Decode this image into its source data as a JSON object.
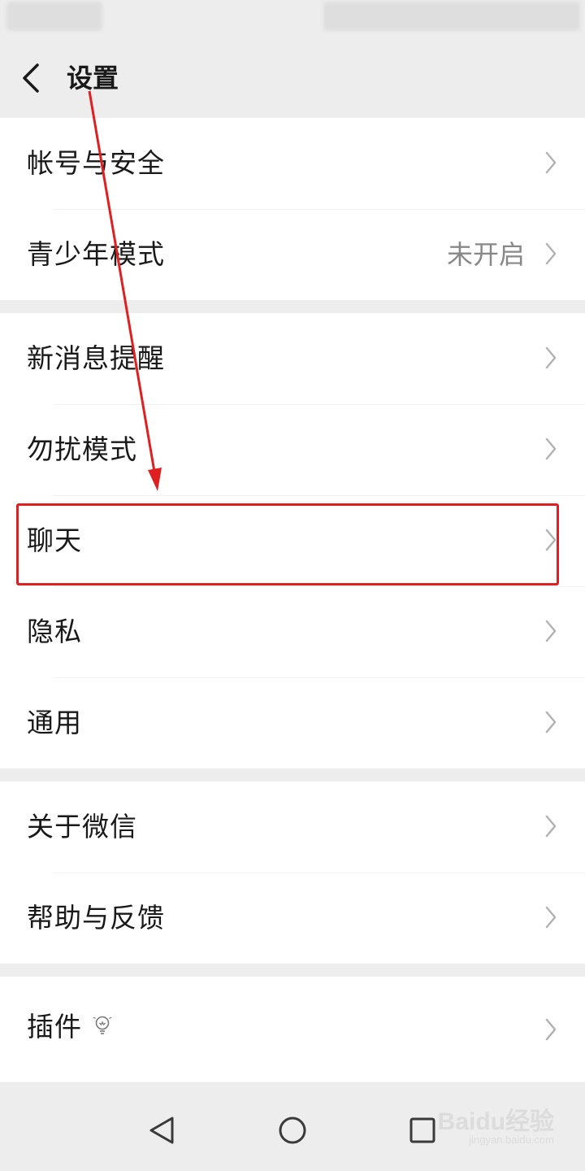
{
  "header": {
    "title": "设置"
  },
  "groups": [
    {
      "items": [
        {
          "label": "帐号与安全",
          "value": ""
        },
        {
          "label": "青少年模式",
          "value": "未开启"
        }
      ]
    },
    {
      "items": [
        {
          "label": "新消息提醒",
          "value": ""
        },
        {
          "label": "勿扰模式",
          "value": ""
        },
        {
          "label": "聊天",
          "value": ""
        },
        {
          "label": "隐私",
          "value": ""
        },
        {
          "label": "通用",
          "value": ""
        }
      ]
    },
    {
      "items": [
        {
          "label": "关于微信",
          "value": ""
        },
        {
          "label": "帮助与反馈",
          "value": ""
        }
      ]
    },
    {
      "items": [
        {
          "label": "插件",
          "value": "",
          "badge_icon": "lightbulb-icon"
        }
      ]
    }
  ],
  "annotation": {
    "color": "#e02020",
    "highlighted_item": "聊天"
  },
  "navbar": {
    "icons": [
      "back-triangle-icon",
      "home-circle-icon",
      "recents-square-icon"
    ]
  },
  "watermark": {
    "line1": "Baidu经验",
    "line2": "jingyan.baidu.com"
  }
}
